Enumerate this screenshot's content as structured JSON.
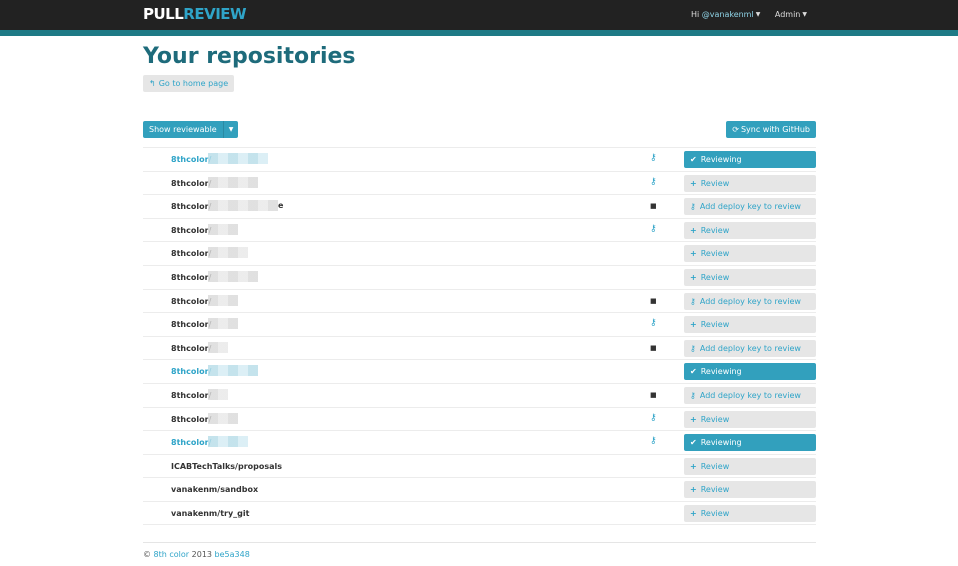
{
  "navbar": {
    "brand_part1": "PULL",
    "brand_part2": "REVIEW",
    "greeting": "Hi",
    "username": "@vanakenml",
    "admin": "Admin"
  },
  "page": {
    "title": "Your repositories",
    "home_button": "Go to home page"
  },
  "toolbar": {
    "show_label": "Show reviewable",
    "sync_label": "Sync with GitHub"
  },
  "repos": [
    {
      "name": "8thcolor/",
      "active": true,
      "icon": "key",
      "action": "Reviewing",
      "style": "blue"
    },
    {
      "name": "8thcolor/",
      "active": false,
      "icon": "key",
      "action": "Review",
      "style": "gray"
    },
    {
      "name": "8thcolor/",
      "active": false,
      "icon": "lock",
      "action": "Add deploy key to review",
      "style": "gray",
      "suffix": "e"
    },
    {
      "name": "8thcolor/",
      "active": false,
      "icon": "key",
      "action": "Review",
      "style": "gray"
    },
    {
      "name": "8thcolor/",
      "active": false,
      "icon": "",
      "action": "Review",
      "style": "gray"
    },
    {
      "name": "8thcolor/",
      "active": false,
      "icon": "",
      "action": "Review",
      "style": "gray"
    },
    {
      "name": "8thcolor/",
      "active": false,
      "icon": "lock",
      "action": "Add deploy key to review",
      "style": "gray"
    },
    {
      "name": "8thcolor/",
      "active": false,
      "icon": "key",
      "action": "Review",
      "style": "gray"
    },
    {
      "name": "8thcolor/",
      "active": false,
      "icon": "lock",
      "action": "Add deploy key to review",
      "style": "gray"
    },
    {
      "name": "8thcolor/",
      "active": true,
      "icon": "",
      "action": "Reviewing",
      "style": "blue"
    },
    {
      "name": "8thcolor/",
      "active": false,
      "icon": "lock",
      "action": "Add deploy key to review",
      "style": "gray"
    },
    {
      "name": "8thcolor/",
      "active": false,
      "icon": "key",
      "action": "Review",
      "style": "gray"
    },
    {
      "name": "8thcolor/",
      "active": true,
      "icon": "key",
      "action": "Reviewing",
      "style": "blue"
    },
    {
      "name": "ICABTechTalks/proposals",
      "active": false,
      "icon": "",
      "action": "Review",
      "style": "gray"
    },
    {
      "name": "vanakenm/sandbox",
      "active": false,
      "icon": "",
      "action": "Review",
      "style": "gray"
    },
    {
      "name": "vanakenm/try_git",
      "active": false,
      "icon": "",
      "action": "Review",
      "style": "gray"
    }
  ],
  "footer": {
    "copyright": "©",
    "company": "8th color",
    "year": "2013",
    "commit": "be5a348"
  },
  "colors": {
    "accent": "#32a0bd",
    "title": "#1e6b7b",
    "navbar": "#222222"
  }
}
